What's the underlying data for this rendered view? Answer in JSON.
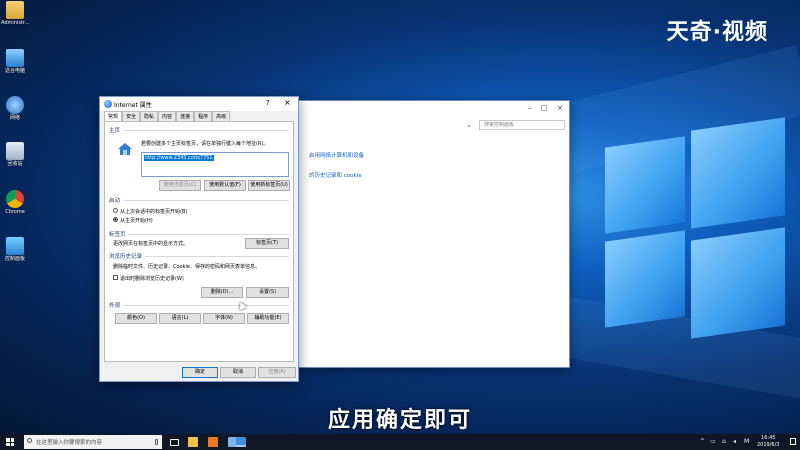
{
  "watermark": "天奇·视频",
  "subtitle": "应用确定即可",
  "desktop_icons": [
    {
      "label": "Administr...",
      "icon": "user-folder-icon"
    },
    {
      "label": "这台电脑",
      "icon": "computer-icon"
    },
    {
      "label": "网络",
      "icon": "network-icon"
    },
    {
      "label": "回收站",
      "icon": "recycle-bin-icon"
    },
    {
      "label": "Chrome",
      "icon": "chrome-icon"
    },
    {
      "label": "控制面板",
      "icon": "control-panel-icon"
    }
  ],
  "control_panel": {
    "search_placeholder": "搜索控制面板",
    "link1": "启用网络计算机和设备",
    "link2": "的历史记录和 cookie"
  },
  "dialog": {
    "title": "Internet 属性",
    "help": "?",
    "close": "×",
    "tabs": [
      "常规",
      "安全",
      "隐私",
      "内容",
      "连接",
      "程序",
      "高级"
    ],
    "home_section": "主页",
    "home_desc": "若要创建多个主页标签页，请在单独行键入每个地址(R)。",
    "home_url": "http://www.2345.com/?751",
    "btn_use_current": "使用当前页(C)",
    "btn_use_default": "使用默认值(F)",
    "btn_use_new_tab": "使用新标签页(U)",
    "startup_section": "启动",
    "radio_last_session": "从上次会话中的标签页开始(B)",
    "radio_home": "从主页开始(H)",
    "tabs_section": "标签页",
    "tabs_desc": "更改网页在标签页中的显示方式。",
    "btn_tabs": "标签页(T)",
    "history_section": "浏览历史记录",
    "history_desc": "删除临时文件、历史记录、Cookie、保存的密码和网页表单信息。",
    "check_delete_on_exit": "退出时删除浏览历史记录(W)",
    "btn_delete": "删除(D)...",
    "btn_settings": "设置(S)",
    "appearance_section": "外观",
    "btn_colors": "颜色(O)",
    "btn_languages": "语言(L)",
    "btn_fonts": "字体(N)",
    "btn_accessibility": "辅助功能(E)",
    "btn_ok": "确定",
    "btn_cancel": "取消",
    "btn_apply": "应用(A)"
  },
  "taskbar": {
    "search_placeholder": "在这里输入你要搜索的内容",
    "time": "16:45",
    "date": "2019/6/3",
    "ime": "M"
  }
}
